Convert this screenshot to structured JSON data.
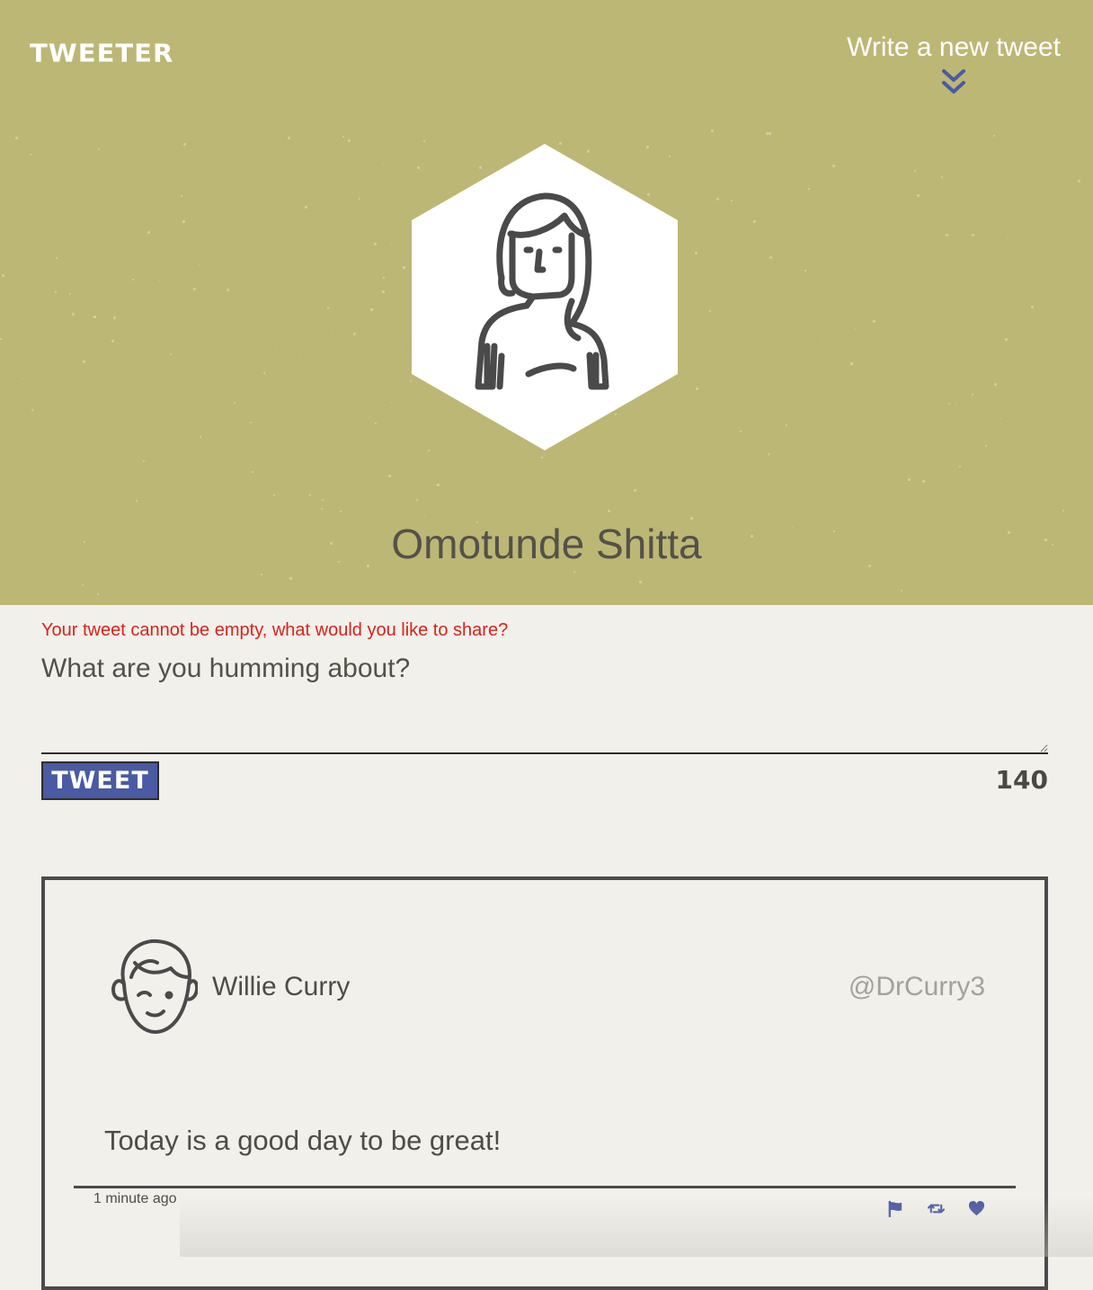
{
  "nav": {
    "logo": "TWEETER",
    "write_new": "Write a new tweet",
    "write_new_icon": "double-chevron-down-icon"
  },
  "profile": {
    "name": "Omotunde Shitta",
    "avatar_icon": "woman-avatar-icon"
  },
  "compose": {
    "error": "Your tweet cannot be empty, what would you like to share?",
    "placeholder": "What are you humming about?",
    "value": "",
    "button_label": "TWEET",
    "counter": "140"
  },
  "tweets": [
    {
      "name": "Willie Curry",
      "handle": "@DrCurry3",
      "content": "Today is a good day to be great!",
      "time": "1 minute ago",
      "avatar_icon": "boy-avatar-icon",
      "actions": [
        "flag-icon",
        "retweet-icon",
        "heart-icon"
      ]
    }
  ],
  "colors": {
    "header_bg": "#bcb775",
    "page_bg": "#f2f0eb",
    "accent": "#4a5aa3",
    "error": "#d8231b",
    "text": "#545149"
  }
}
